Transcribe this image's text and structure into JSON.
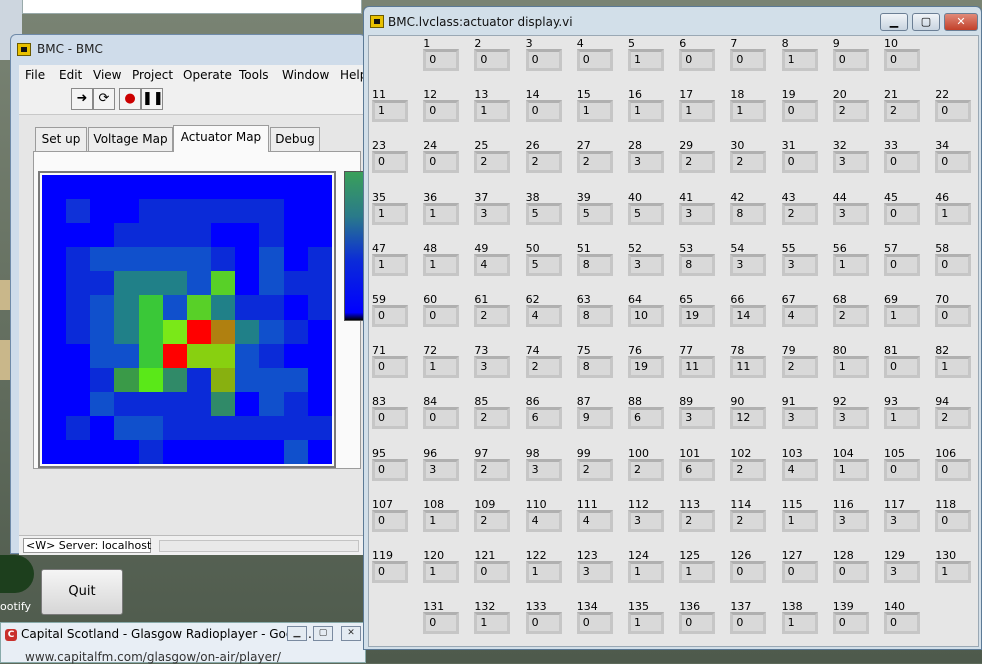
{
  "desktop": {
    "spotify_label": "ootify",
    "radio_window": {
      "title": "Capital Scotland - Glasgow Radioplayer - Googl...",
      "url": "www.capitalfm.com/glasgow/on-air/player/"
    }
  },
  "bmc_window": {
    "title": "BMC - BMC",
    "menu": [
      "File",
      "Edit",
      "View",
      "Project",
      "Operate",
      "Tools",
      "Window",
      "Help"
    ],
    "toolbar_icons": [
      "run-arrow-icon",
      "run-continuous-icon",
      "abort-icon",
      "pause-icon"
    ],
    "tabs": [
      "Set up",
      "Voltage Map",
      "Actuator Map",
      "Debug"
    ],
    "active_tab": "Actuator Map",
    "quit_label": "Quit",
    "status_text": "<W> Server: localhost",
    "heatmap": {
      "rows": 12,
      "cols": 12,
      "colors": [
        "#0000ff",
        "#0000ff",
        "#0000ff",
        "#0000ff",
        "#0000ff",
        "#0000ff",
        "#0000ff",
        "#0000ff",
        "#0000ff",
        "#0000ff",
        "#0000ff",
        "#0000ff",
        "#0000ff",
        "#1032d8",
        "#0000ff",
        "#0000ff",
        "#0b2bd8",
        "#0b2bd8",
        "#0b2bd8",
        "#0b2bd8",
        "#0b2bd8",
        "#0b2bd8",
        "#0000ff",
        "#0000ff",
        "#0000ff",
        "#0000ff",
        "#0000ff",
        "#0b2bd8",
        "#0b2bd8",
        "#0b2bd8",
        "#0b2bd8",
        "#0000ff",
        "#0000ff",
        "#0b2bd8",
        "#0000ff",
        "#0000ff",
        "#0000ff",
        "#0b2bd8",
        "#1050cc",
        "#1050cc",
        "#1050cc",
        "#1050cc",
        "#1050cc",
        "#0b2bd8",
        "#0000ff",
        "#1050cc",
        "#0000ff",
        "#0b2bd8",
        "#0000ff",
        "#0b2bd8",
        "#0b2bd8",
        "#208088",
        "#208088",
        "#208088",
        "#1050cc",
        "#58d028",
        "#0000ff",
        "#1050cc",
        "#0b2bd8",
        "#0b2bd8",
        "#0000ff",
        "#0b2bd8",
        "#1050cc",
        "#208088",
        "#3ac838",
        "#1050cc",
        "#58d028",
        "#208088",
        "#0b2bd8",
        "#0b2bd8",
        "#0000ff",
        "#0b2bd8",
        "#0000ff",
        "#0b2bd8",
        "#1050cc",
        "#208088",
        "#3ac838",
        "#7ae818",
        "#ff0000",
        "#b08010",
        "#208088",
        "#1050cc",
        "#0b2bd8",
        "#0000ff",
        "#0000ff",
        "#0000ff",
        "#1050cc",
        "#1050cc",
        "#3ac838",
        "#ff0000",
        "#88d010",
        "#88d010",
        "#1050cc",
        "#0b2bd8",
        "#0000ff",
        "#0000ff",
        "#0000ff",
        "#0000ff",
        "#0b2bd8",
        "#3a9a48",
        "#5ae818",
        "#308a68",
        "#0b2bd8",
        "#88b010",
        "#1050cc",
        "#1050cc",
        "#1050cc",
        "#0000ff",
        "#0000ff",
        "#0000ff",
        "#1050cc",
        "#0b2bd8",
        "#0b2bd8",
        "#0b2bd8",
        "#0b2bd8",
        "#308a68",
        "#0000ff",
        "#1050cc",
        "#0b2bd8",
        "#0000ff",
        "#0000ff",
        "#0b2bd8",
        "#0000ff",
        "#1050cc",
        "#1050cc",
        "#0b2bd8",
        "#0b2bd8",
        "#0b2bd8",
        "#0b2bd8",
        "#0b2bd8",
        "#0b2bd8",
        "#0b2bd8",
        "#0000ff",
        "#0000ff",
        "#0000ff",
        "#0000ff",
        "#0b2bd8",
        "#0000ff",
        "#0000ff",
        "#0000ff",
        "#0000ff",
        "#0000ff",
        "#1050cc",
        "#0000ff"
      ]
    }
  },
  "actuator_window": {
    "title": "BMC.lvclass:actuator display.vi",
    "rows": [
      {
        "labels": [
          "1",
          "2",
          "3",
          "4",
          "5",
          "6",
          "7",
          "8",
          "9",
          "10"
        ],
        "values": [
          "0",
          "0",
          "0",
          "0",
          "1",
          "0",
          "0",
          "1",
          "0",
          "0"
        ],
        "offset": 1
      },
      {
        "labels": [
          "11",
          "12",
          "13",
          "14",
          "15",
          "16",
          "17",
          "18",
          "19",
          "20",
          "21",
          "22"
        ],
        "values": [
          "1",
          "0",
          "1",
          "0",
          "1",
          "1",
          "1",
          "1",
          "0",
          "2",
          "2",
          "0"
        ],
        "offset": 0
      },
      {
        "labels": [
          "23",
          "24",
          "25",
          "26",
          "27",
          "28",
          "29",
          "30",
          "31",
          "32",
          "33",
          "34"
        ],
        "values": [
          "0",
          "0",
          "2",
          "2",
          "2",
          "3",
          "2",
          "2",
          "0",
          "3",
          "0",
          "0"
        ],
        "offset": 0
      },
      {
        "labels": [
          "35",
          "36",
          "37",
          "38",
          "39",
          "40",
          "41",
          "42",
          "43",
          "44",
          "45",
          "46"
        ],
        "values": [
          "1",
          "1",
          "3",
          "5",
          "5",
          "5",
          "3",
          "8",
          "2",
          "3",
          "0",
          "1"
        ],
        "offset": 0
      },
      {
        "labels": [
          "47",
          "48",
          "49",
          "50",
          "51",
          "52",
          "53",
          "54",
          "55",
          "56",
          "57",
          "58"
        ],
        "values": [
          "1",
          "1",
          "4",
          "5",
          "8",
          "3",
          "8",
          "3",
          "3",
          "1",
          "0",
          "0"
        ],
        "offset": 0
      },
      {
        "labels": [
          "59",
          "60",
          "61",
          "62",
          "63",
          "64",
          "65",
          "66",
          "67",
          "68",
          "69",
          "70"
        ],
        "values": [
          "0",
          "0",
          "2",
          "4",
          "8",
          "10",
          "19",
          "14",
          "4",
          "2",
          "1",
          "0"
        ],
        "offset": 0
      },
      {
        "labels": [
          "71",
          "72",
          "73",
          "74",
          "75",
          "76",
          "77",
          "78",
          "79",
          "80",
          "81",
          "82"
        ],
        "values": [
          "0",
          "1",
          "3",
          "2",
          "8",
          "19",
          "11",
          "11",
          "2",
          "1",
          "0",
          "1"
        ],
        "offset": 0
      },
      {
        "labels": [
          "83",
          "84",
          "85",
          "86",
          "87",
          "88",
          "89",
          "90",
          "91",
          "92",
          "93",
          "94"
        ],
        "values": [
          "0",
          "0",
          "2",
          "6",
          "9",
          "6",
          "3",
          "12",
          "3",
          "3",
          "1",
          "2"
        ],
        "offset": 0
      },
      {
        "labels": [
          "95",
          "96",
          "97",
          "98",
          "99",
          "100",
          "101",
          "102",
          "103",
          "104",
          "105",
          "106"
        ],
        "values": [
          "0",
          "3",
          "2",
          "3",
          "2",
          "2",
          "6",
          "2",
          "4",
          "1",
          "0",
          "0"
        ],
        "offset": 0
      },
      {
        "labels": [
          "107",
          "108",
          "109",
          "110",
          "111",
          "112",
          "113",
          "114",
          "115",
          "116",
          "117",
          "118"
        ],
        "values": [
          "0",
          "1",
          "2",
          "4",
          "4",
          "3",
          "2",
          "2",
          "1",
          "3",
          "3",
          "0"
        ],
        "offset": 0
      },
      {
        "labels": [
          "119",
          "120",
          "121",
          "122",
          "123",
          "124",
          "125",
          "126",
          "127",
          "128",
          "129",
          "130"
        ],
        "values": [
          "0",
          "1",
          "0",
          "1",
          "3",
          "1",
          "1",
          "0",
          "0",
          "0",
          "3",
          "1"
        ],
        "offset": 0
      },
      {
        "labels": [
          "131",
          "132",
          "133",
          "134",
          "135",
          "136",
          "137",
          "138",
          "139",
          "140"
        ],
        "values": [
          "0",
          "1",
          "0",
          "0",
          "1",
          "0",
          "0",
          "1",
          "0",
          "0"
        ],
        "offset": 1
      }
    ]
  }
}
